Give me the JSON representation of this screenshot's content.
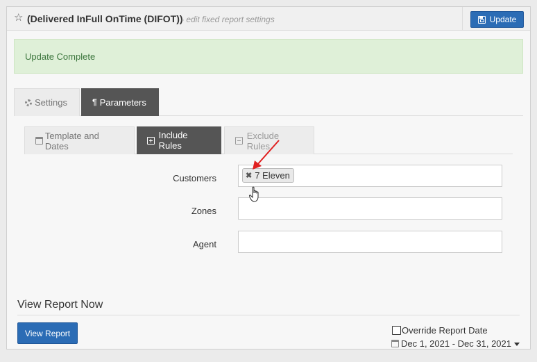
{
  "header": {
    "title": "(Delivered InFull OnTime (DIFOT))",
    "subtitle": "- edit fixed report settings",
    "update_label": "Update"
  },
  "alert": {
    "text": "Update Complete"
  },
  "main_tabs": [
    {
      "label": "Settings",
      "icon": "gear-icon",
      "active": false
    },
    {
      "label": "Parameters",
      "icon": "pilcrow-icon",
      "active": true
    }
  ],
  "sub_tabs": [
    {
      "label": "Template and Dates",
      "icon": "calendar-icon",
      "active": false
    },
    {
      "label": "Include Rules",
      "icon": "plus-square-icon",
      "active": true
    },
    {
      "label": "Exclude Rules",
      "icon": "minus-square-icon",
      "active": false
    }
  ],
  "fields": {
    "customers": {
      "label": "Customers",
      "tags": [
        "7 Eleven"
      ]
    },
    "zones": {
      "label": "Zones",
      "value": ""
    },
    "agent": {
      "label": "Agent",
      "value": ""
    }
  },
  "view_report": {
    "section_title": "View Report Now",
    "button_label": "View Report",
    "override_label": "Override Report Date",
    "date_range": "Dec 1, 2021 - Dec 31, 2021"
  },
  "colors": {
    "primary": "#2b6cb5",
    "alert_bg": "#dff0d8",
    "alert_text": "#3c763d",
    "active_tab": "#555555",
    "annotation_arrow": "#e02020"
  }
}
